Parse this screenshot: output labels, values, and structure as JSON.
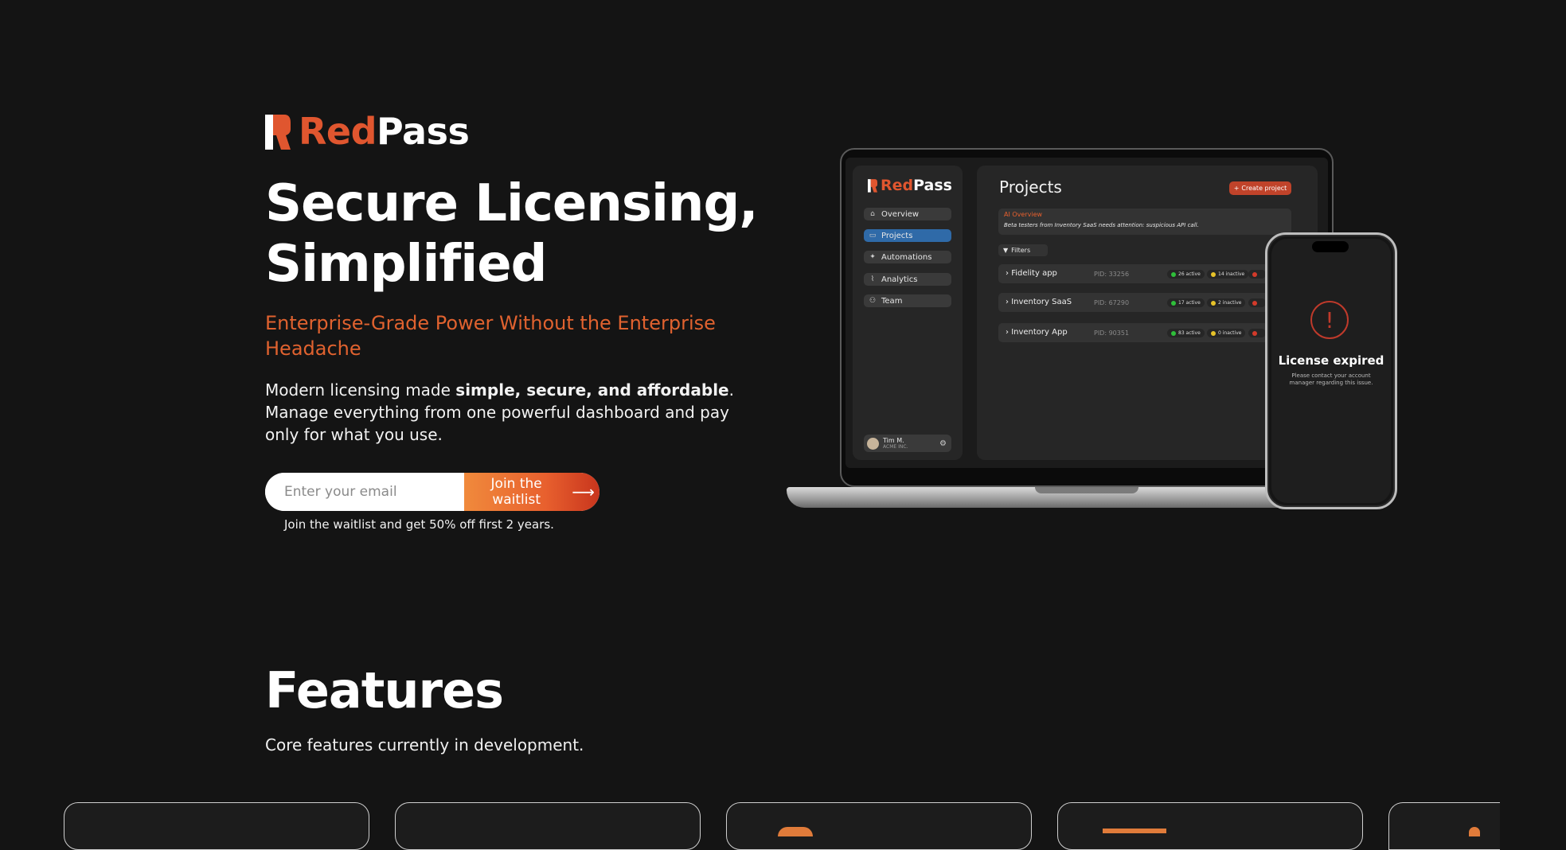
{
  "brand": {
    "name_red": "Red",
    "name_white": "Pass"
  },
  "hero": {
    "title_line1": "Secure Licensing,",
    "title_line2": "Simplified",
    "subtitle": "Enterprise-Grade Power Without the Enterprise Headache",
    "desc_prefix": "Modern licensing made ",
    "desc_bold": "simple, secure, and affordable",
    "desc_suffix": ". Manage everything from one powerful dashboard and pay only for what you use."
  },
  "waitlist": {
    "placeholder": "Enter your email",
    "button_label": "Join the waitlist",
    "button_arrow": "⟶",
    "note": "Join the waitlist and get 50% off first 2 years."
  },
  "mockup": {
    "sidebar": [
      {
        "label": "Overview",
        "icon": "home-icon",
        "active": false
      },
      {
        "label": "Projects",
        "icon": "folder-icon",
        "active": true
      },
      {
        "label": "Automations",
        "icon": "wand-icon",
        "active": false
      },
      {
        "label": "Analytics",
        "icon": "chart-icon",
        "active": false
      },
      {
        "label": "Team",
        "icon": "user-icon",
        "active": false
      }
    ],
    "user": {
      "name": "Tim M.",
      "org": "ACME INC."
    },
    "page_title": "Projects",
    "create_button": "Create project",
    "ai_overview": {
      "title": "AI Overview",
      "text": "Beta testers from Inventory SaaS needs attention: suspicious API call."
    },
    "filters_label": "Filters",
    "projects": [
      {
        "name": "Fidelity app",
        "pid": "PID: 33256",
        "active": "26 active",
        "inactive": "14 inactive"
      },
      {
        "name": "Inventory SaaS",
        "pid": "PID: 67290",
        "active": "17 active",
        "inactive": "2 inactive"
      },
      {
        "name": "Inventory App",
        "pid": "PID: 90351",
        "active": "83 active",
        "inactive": "0 inactive"
      }
    ],
    "phone": {
      "title": "License expired",
      "text": "Please contact your account manager regarding this issue."
    }
  },
  "features": {
    "title": "Features",
    "subtitle": "Core features currently in development."
  },
  "colors": {
    "accent": "#e0562f",
    "background": "#141414",
    "active_nav": "#2f6aa8",
    "status_green": "#2fbf3a",
    "status_yellow": "#e6c229",
    "status_red": "#d33a2a"
  }
}
